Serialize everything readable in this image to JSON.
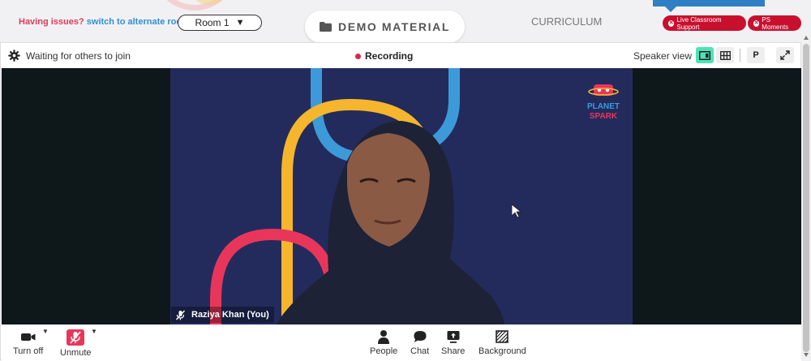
{
  "topbar": {
    "issues_question": "Having issues?",
    "issues_link": "switch to alternate room",
    "room_selected": "Room 1",
    "room_caret": "▼",
    "demo_label": "DEMO MATERIAL",
    "curriculum_label": "CURRICULUM",
    "live_support_label": "Live Classroom Support",
    "moments_label": "PS Moments"
  },
  "meeting": {
    "status_text": "Waiting for others to join",
    "recording_label": "Recording",
    "view_label": "Speaker view",
    "p_button_label": "P",
    "participant_name": "Raziya Khan (You)",
    "logo_text_top": "PLANET",
    "logo_text_bottom": "SPARK"
  },
  "controls": {
    "video_label": "Turn off",
    "audio_label": "Unmute",
    "people_label": "People",
    "chat_label": "Chat",
    "share_label": "Share",
    "background_label": "Background"
  },
  "colors": {
    "accent_red": "#c8102e",
    "link_blue": "#2f8fd8",
    "recording_dot": "#e0254a",
    "active_view": "#4ee2b7",
    "video_bg": "#232b5d",
    "arch_blue": "#3d9ad9",
    "arch_yellow": "#f5b62d",
    "arch_red": "#e8365b"
  },
  "icons": {
    "settings": "gear-icon",
    "folder": "folder-icon",
    "camera": "video-camera-icon",
    "mic": "mic-muted-icon",
    "people": "person-icon",
    "chat": "chat-bubble-icon",
    "share": "share-screen-icon",
    "background": "background-icon",
    "fullscreen": "expand-icon"
  }
}
